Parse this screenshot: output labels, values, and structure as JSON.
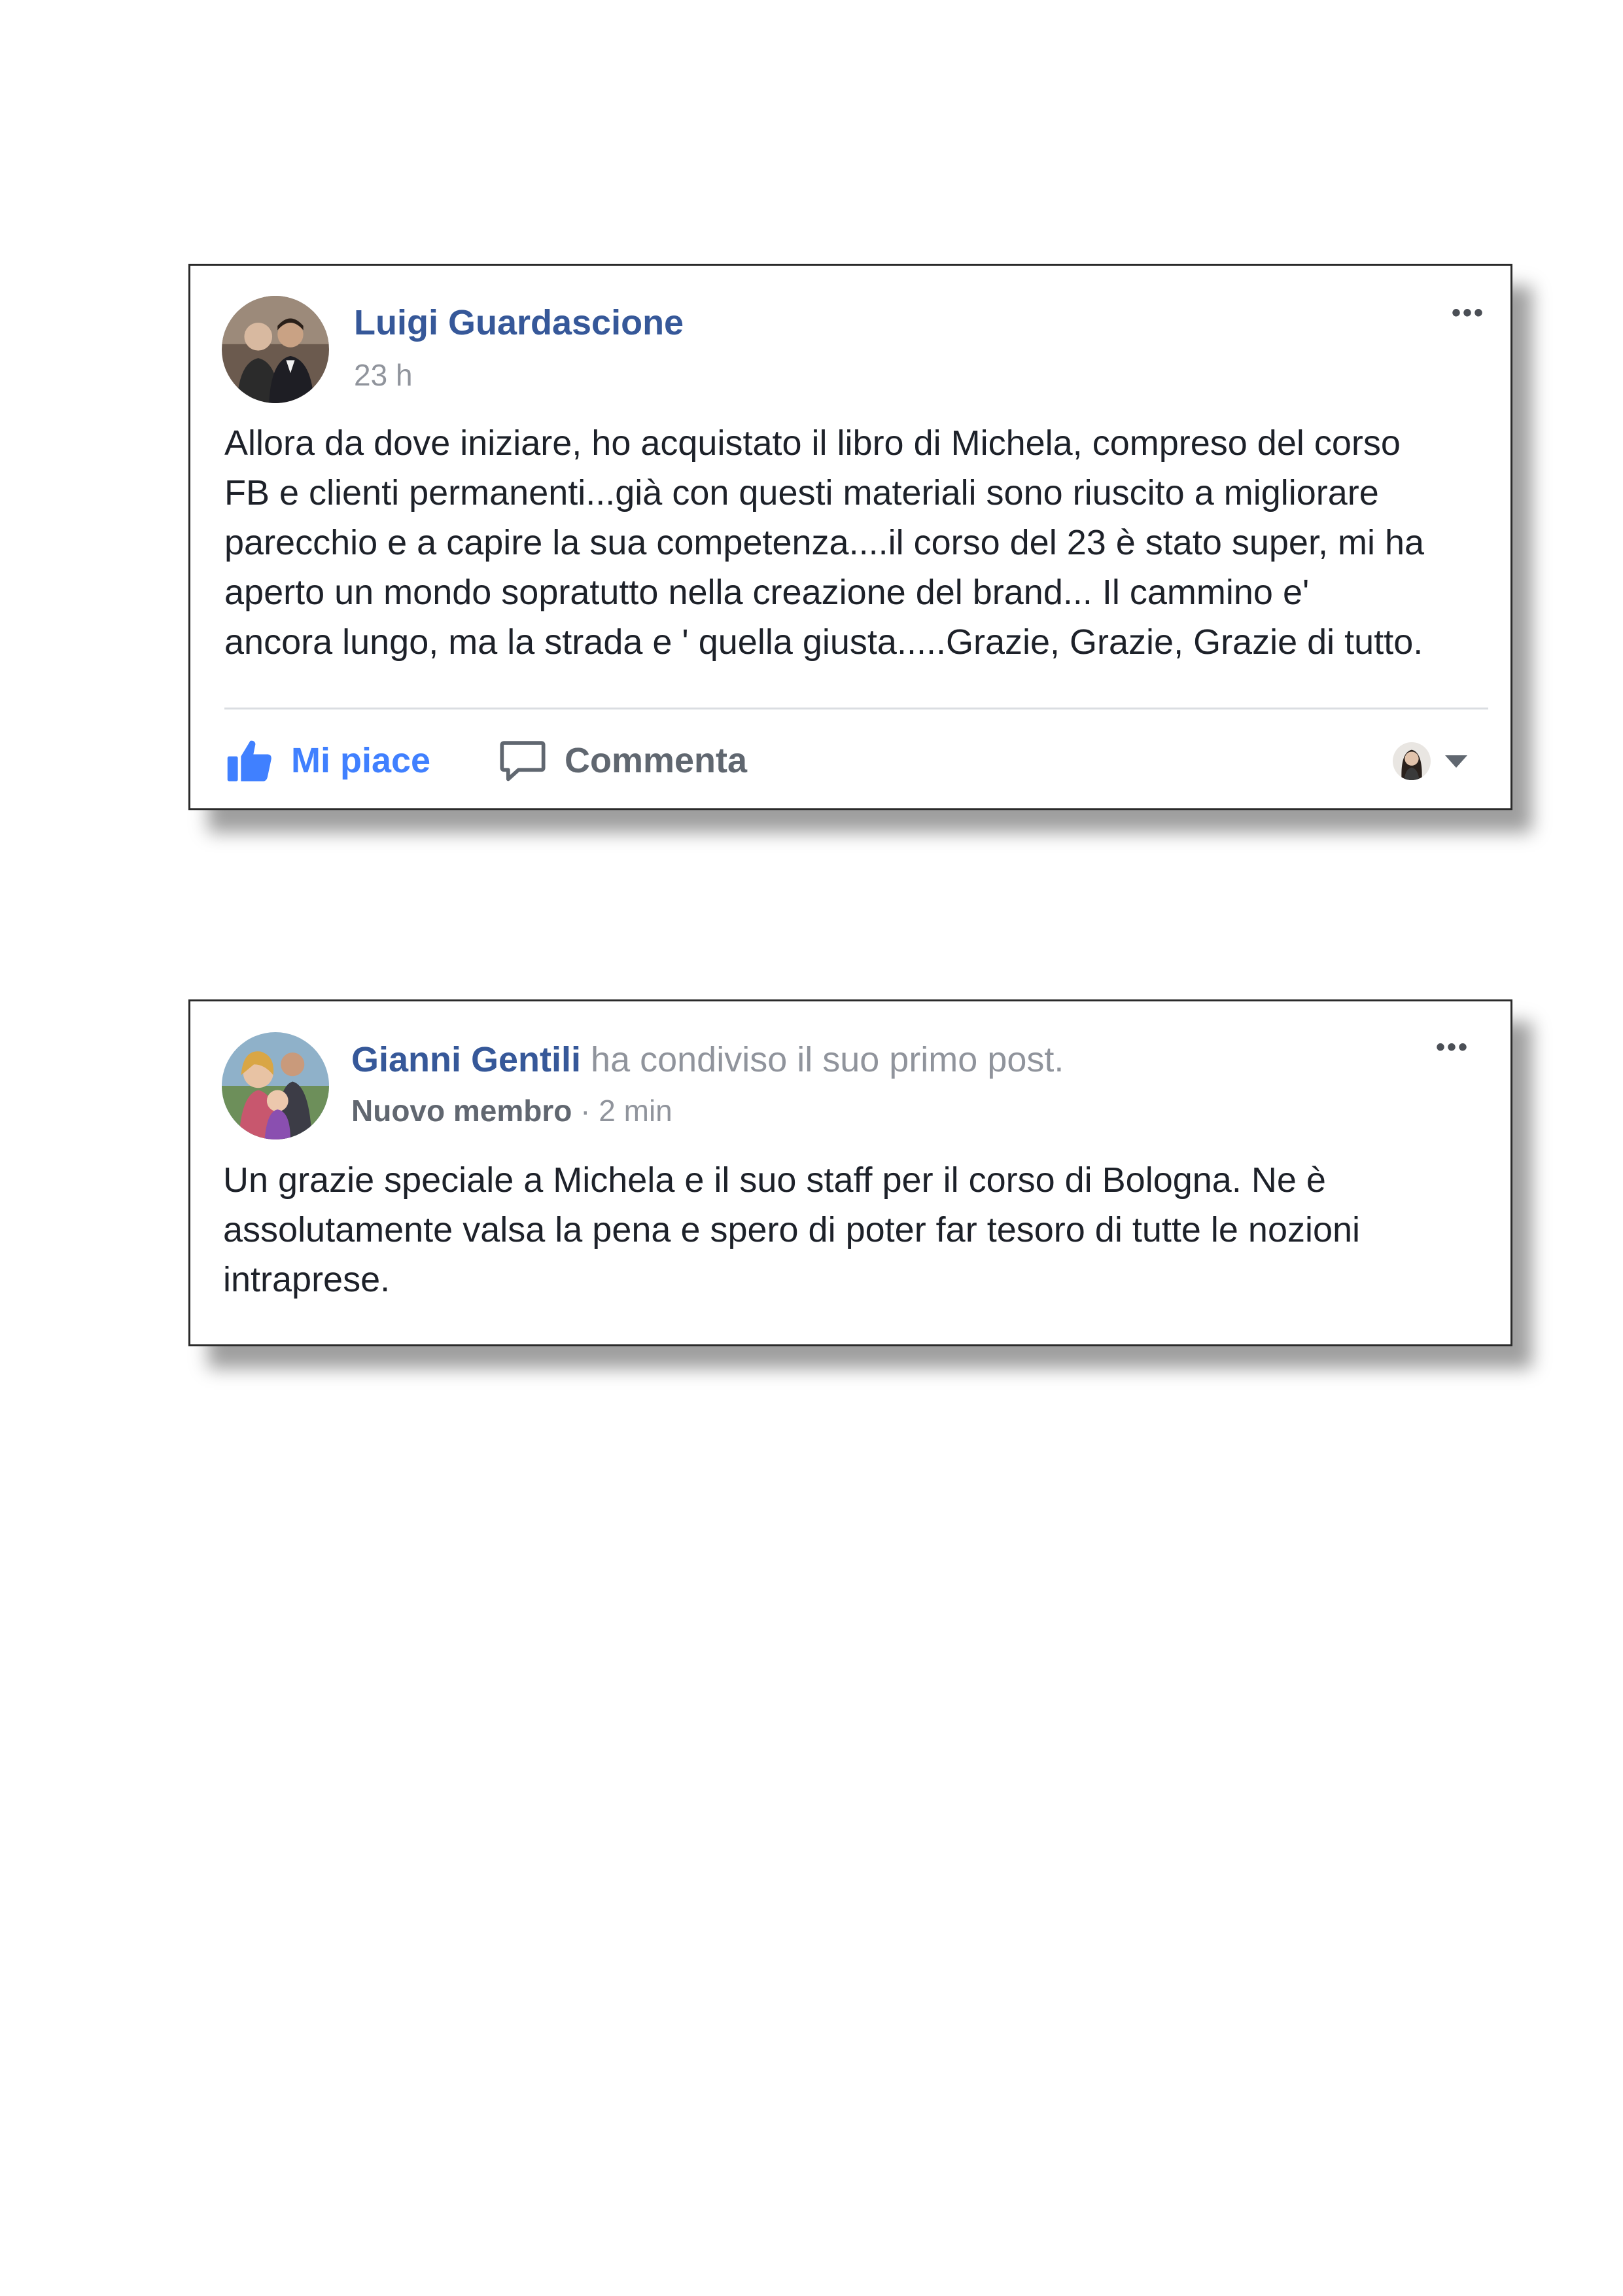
{
  "post1": {
    "author": "Luigi Guardascione",
    "timestamp": "23 h",
    "more_icon": "more-options-icon",
    "body_lines": [
      "Allora da dove iniziare, ho acquistato il libro di Michela, compreso del corso",
      "FB e clienti permanenti...già con questi materiali sono riuscito a migliorare",
      "parecchio e a capire la sua competenza....il corso del 23 è stato super, mi ha",
      "aperto un mondo sopratutto nella creazione del brand... Il cammino e'",
      "ancora lungo, ma la strada e ' quella giusta.....Grazie, Grazie, Grazie di tutto."
    ],
    "actions": {
      "like_label": "Mi piace",
      "comment_label": "Commenta"
    },
    "colors": {
      "name": "#365899",
      "like": "#4080ff"
    }
  },
  "post2": {
    "author": "Gianni Gentili",
    "action_text": " ha condiviso il suo primo post.",
    "badge": "Nuovo membro",
    "separator": " · ",
    "timestamp": "2 min",
    "more_icon": "more-options-icon",
    "body_lines": [
      "Un grazie speciale a Michela e il suo staff per il corso di Bologna. Ne è",
      "assolutamente valsa la pena e spero di poter far tesoro di tutte le nozioni",
      "intraprese."
    ]
  }
}
